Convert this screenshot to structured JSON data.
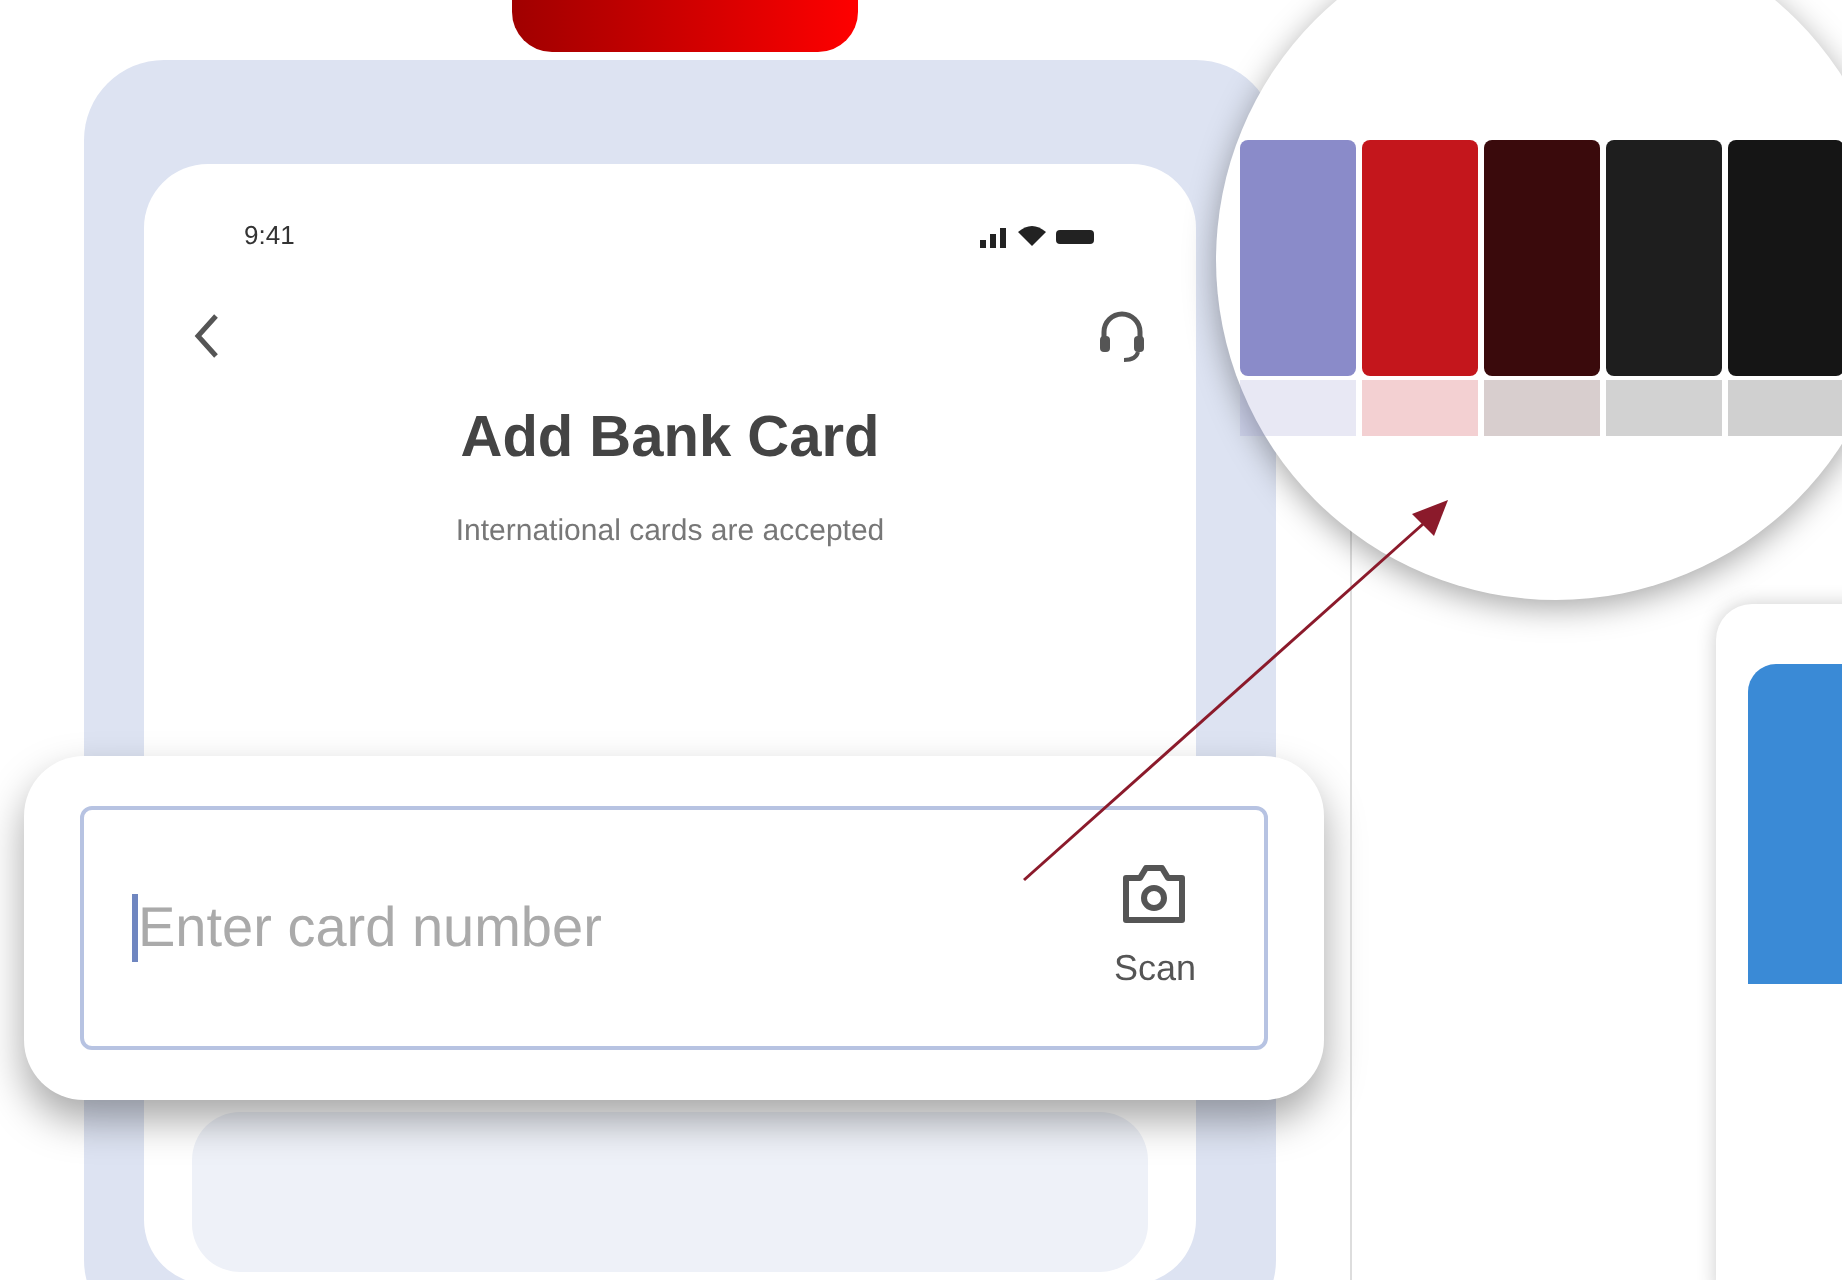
{
  "phone": {
    "status_time": "9:41",
    "title": "Add Bank Card",
    "subtitle": "International cards are accepted",
    "card_field": {
      "placeholder": "Enter card number",
      "focused": true
    },
    "scan_label": "Scan"
  }
}
